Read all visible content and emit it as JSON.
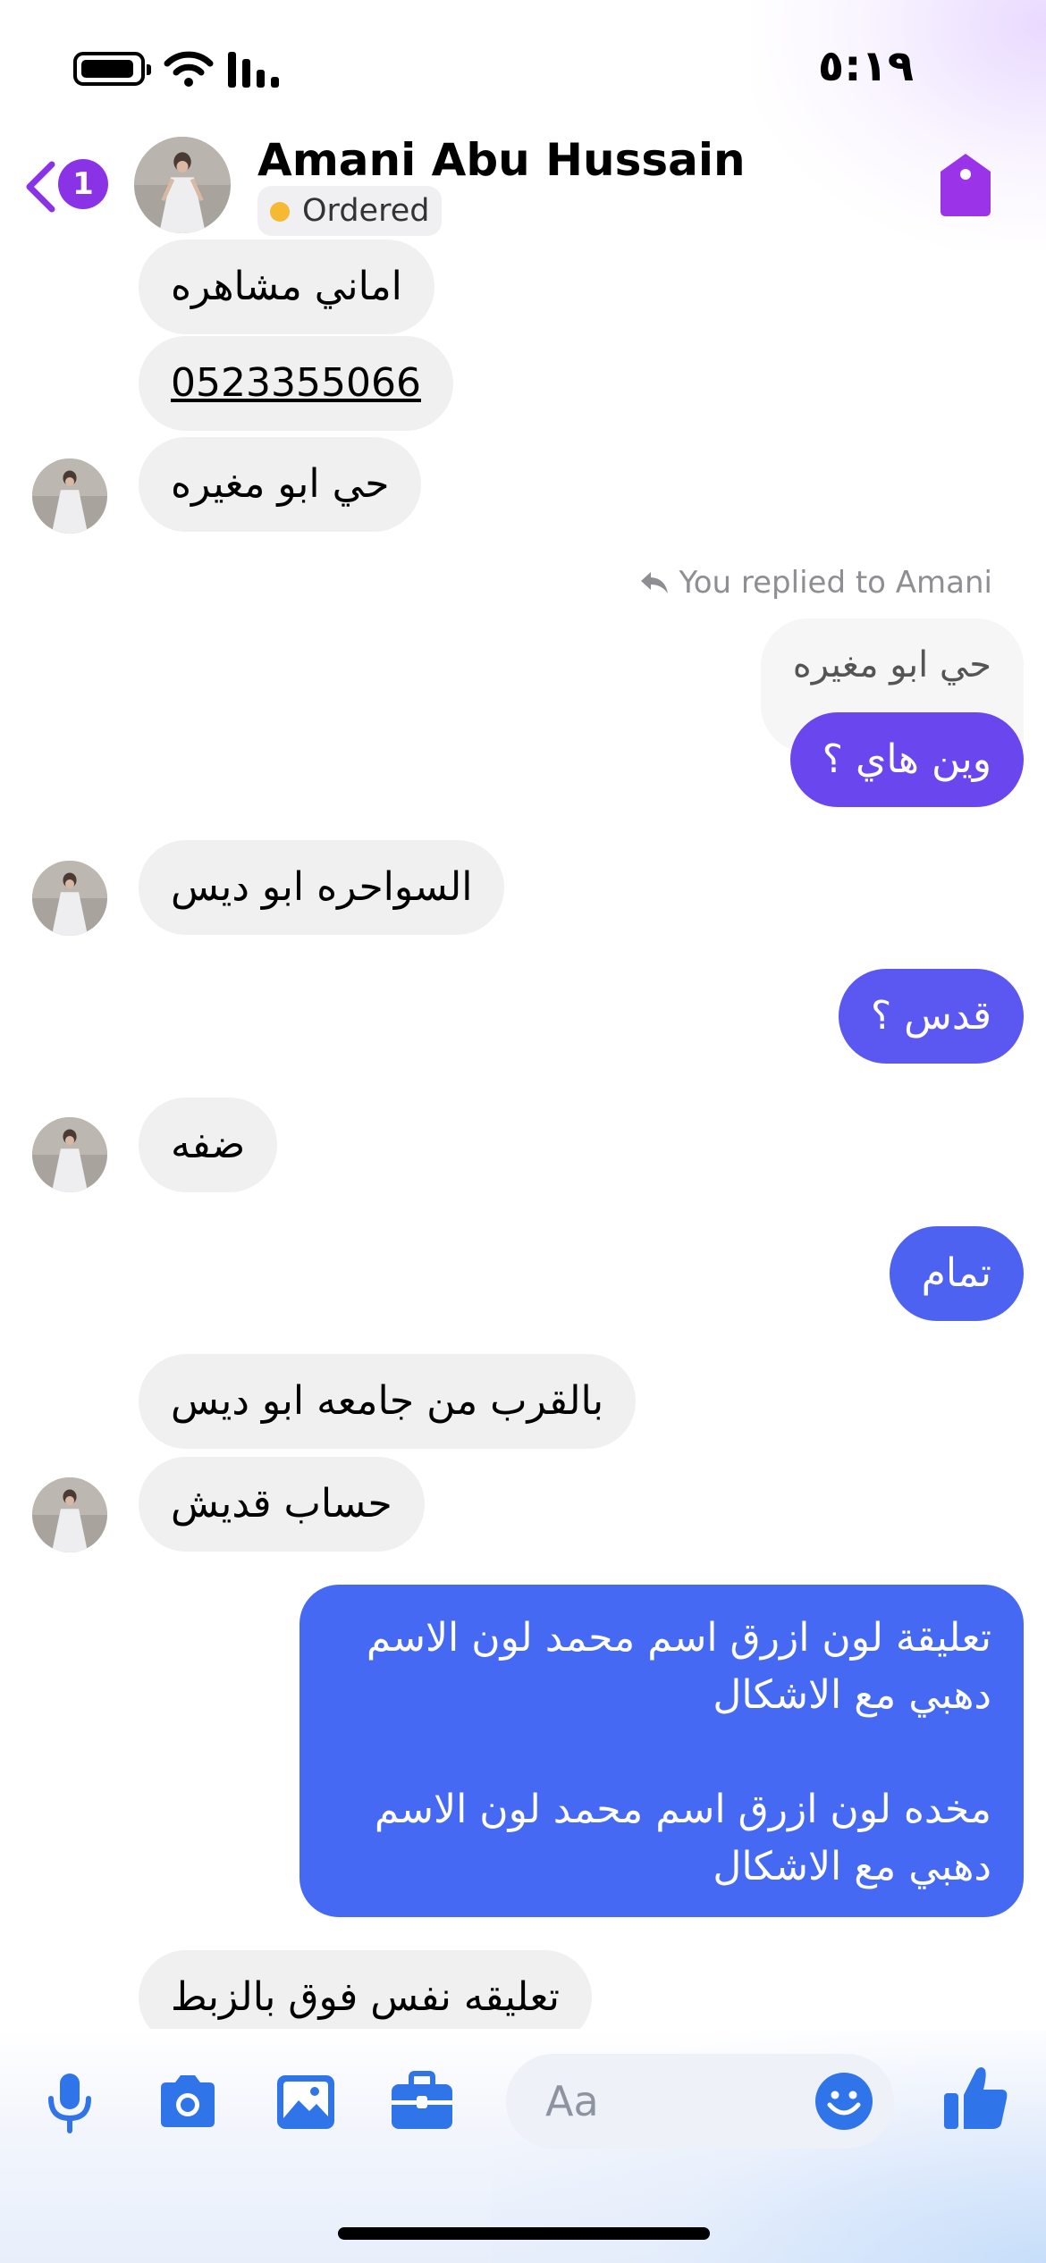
{
  "status_bar": {
    "time": "٥:١٩"
  },
  "header": {
    "back_badge": "1",
    "contact_name": "Amani Abu Hussain",
    "label": "Ordered"
  },
  "colors": {
    "accent_purple": "#8a33e6",
    "label_dot": "#f6b934",
    "incoming_bubble": "#f0f0f0",
    "composer_blue": "#2f74e8"
  },
  "messages": [
    {
      "text": "اماني مشاهره"
    },
    {
      "text": "0523355066"
    },
    {
      "text": "حي ابو مغيره"
    },
    {
      "text": "You replied to Amani"
    },
    {
      "text": "حي ابو مغيره"
    },
    {
      "text": "وين هاي ؟"
    },
    {
      "text": "السواحره ابو ديس"
    },
    {
      "text": "قدس ؟"
    },
    {
      "text": "ضفه"
    },
    {
      "text": "تمام"
    },
    {
      "text": "بالقرب من جامعه ابو ديس"
    },
    {
      "text": "حساب قديش"
    },
    {
      "lines": [
        "تعليقة لون ازرق اسم محمد لون الاسم",
        "دهبي مع الاشكال",
        "مخده لون ازرق اسم محمد لون الاسم",
        "دهبي مع الاشكال"
      ]
    },
    {
      "text": "تعليقه نفس فوق بالزبط"
    }
  ],
  "composer": {
    "placeholder": "Aa",
    "icons": [
      "microphone-icon",
      "camera-icon",
      "gallery-icon",
      "briefcase-icon",
      "emoji-icon",
      "thumbs-up-icon"
    ]
  }
}
